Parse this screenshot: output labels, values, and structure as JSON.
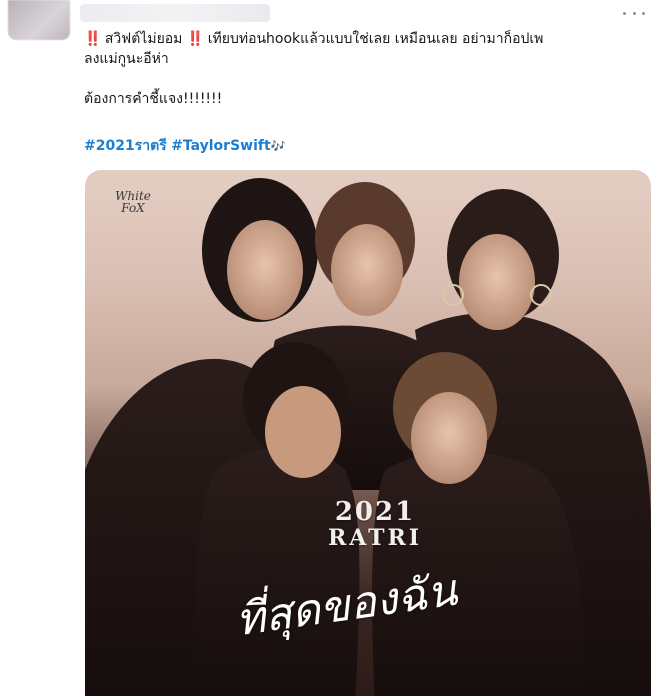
{
  "tweet": {
    "text": {
      "bang": "‼️",
      "line1_part1": " สวิฟต์ไม่ยอม ",
      "line1_part2": " เทียบท่อนhookแล้วแบบใช่เลย เหมือนเลย อย่ามาก็อปเพ",
      "line2": "ลงแม่กูนะอีห่า",
      "line3": "ต้องการคำชี้แจง!!!!!!!"
    },
    "hashtags": [
      "#2021ราตรี",
      "#TaylorSwift"
    ],
    "hashtag_emoji": "🎶",
    "more_icon": "more-horizontal-icon"
  },
  "media": {
    "brand": "White FoX",
    "poster_year": "2021",
    "poster_name": "RATRI",
    "script_title": "ที่สุดของฉัน"
  },
  "colors": {
    "hashtag": "#1d7ed0",
    "bang": "#d0142a",
    "text": "#16181c"
  }
}
